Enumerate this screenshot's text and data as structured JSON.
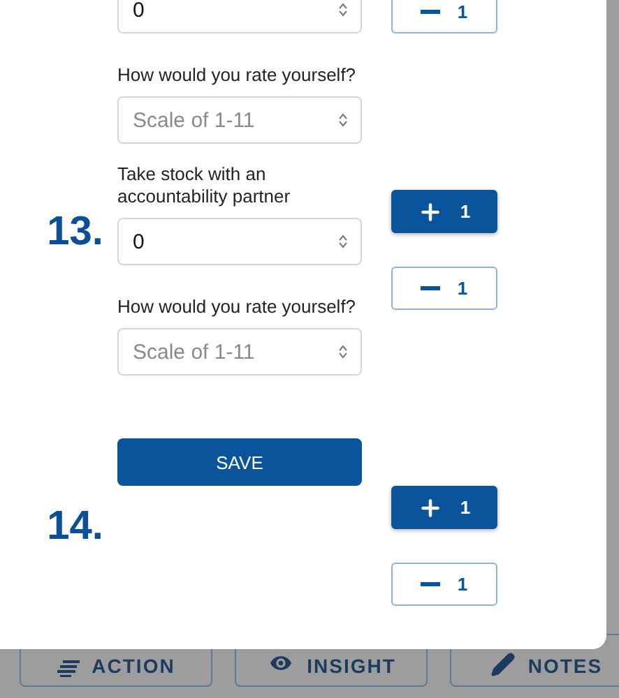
{
  "sections": [
    {
      "kind": "fields",
      "fields": [
        {
          "value": "0"
        },
        {
          "label": "How would you rate yourself?",
          "placeholder": "Scale of 1-11"
        }
      ],
      "buttons": [
        {
          "kind": "minus",
          "label": "1"
        }
      ]
    },
    {
      "kind": "fields",
      "number": "13.",
      "fields": [
        {
          "label": "Take stock with an accountability partner",
          "value": "0"
        },
        {
          "label": "How would you rate yourself?",
          "placeholder": "Scale of 1-11"
        }
      ],
      "buttons": [
        {
          "kind": "plus",
          "label": "1"
        },
        {
          "kind": "minus",
          "label": "1"
        }
      ]
    },
    {
      "kind": "save",
      "number": "14.",
      "save": "SAVE",
      "buttons": [
        {
          "kind": "plus",
          "label": "1"
        },
        {
          "kind": "minus",
          "label": "1"
        }
      ]
    }
  ],
  "bottom_tabs": [
    {
      "kind": "action",
      "label": "ACTION"
    },
    {
      "kind": "insight",
      "label": "INSIGHT"
    },
    {
      "kind": "notes",
      "label": "NOTES"
    }
  ]
}
